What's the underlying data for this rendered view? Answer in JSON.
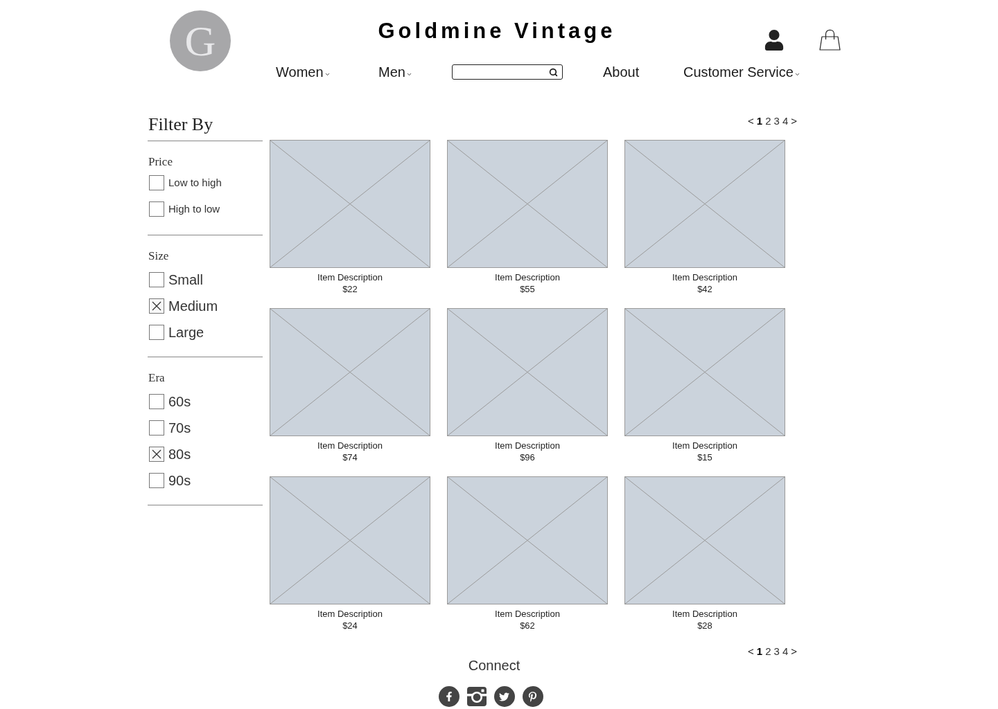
{
  "header": {
    "logo_letter": "G",
    "title": "Goldmine Vintage"
  },
  "nav": [
    {
      "kind": "menu",
      "label": "Women",
      "dropdown": true
    },
    {
      "kind": "menu",
      "label": "Men",
      "dropdown": true
    },
    {
      "kind": "search"
    },
    {
      "kind": "menu",
      "label": "About",
      "dropdown": false
    },
    {
      "kind": "menu",
      "label": "Customer Service",
      "dropdown": true
    }
  ],
  "filters": {
    "title": "Filter By",
    "groups": [
      {
        "title": "Price",
        "kind": "sort",
        "options": [
          {
            "label": "Low to high",
            "checked": false
          },
          {
            "label": "High to low",
            "checked": false
          }
        ]
      },
      {
        "title": "Size",
        "kind": "filter",
        "options": [
          {
            "label": "Small",
            "checked": false
          },
          {
            "label": "Medium",
            "checked": true
          },
          {
            "label": "Large",
            "checked": false
          }
        ]
      },
      {
        "title": "Era",
        "kind": "filter",
        "options": [
          {
            "label": "60s",
            "checked": false
          },
          {
            "label": "70s",
            "checked": false
          },
          {
            "label": "80s",
            "checked": true
          },
          {
            "label": "90s",
            "checked": false
          }
        ]
      }
    ]
  },
  "pagination_top": {
    "prev": "<",
    "pages": [
      {
        "label": "1",
        "selected": true
      },
      {
        "label": "2",
        "selected": false
      },
      {
        "label": "3",
        "selected": false
      },
      {
        "label": "4",
        "selected": false
      }
    ],
    "next": ">"
  },
  "products": [
    {
      "description": "Item Description",
      "price": "$22"
    },
    {
      "description": "Item Description",
      "price": "$55"
    },
    {
      "description": "Item Description",
      "price": "$42"
    },
    {
      "description": "Item Description",
      "price": "$74"
    },
    {
      "description": "Item Description",
      "price": "$96"
    },
    {
      "description": "Item Description",
      "price": "$15"
    },
    {
      "description": "Item Description",
      "price": "$24"
    },
    {
      "description": "Item Description",
      "price": "$62"
    },
    {
      "description": "Item Description",
      "price": "$28"
    }
  ],
  "pagination_bottom": {
    "prev": "<",
    "pages": [
      {
        "label": "1",
        "selected": true
      },
      {
        "label": "2",
        "selected": false
      },
      {
        "label": "3",
        "selected": false
      },
      {
        "label": "4",
        "selected": false
      }
    ],
    "next": ">"
  },
  "footer": {
    "title": "Connect"
  }
}
